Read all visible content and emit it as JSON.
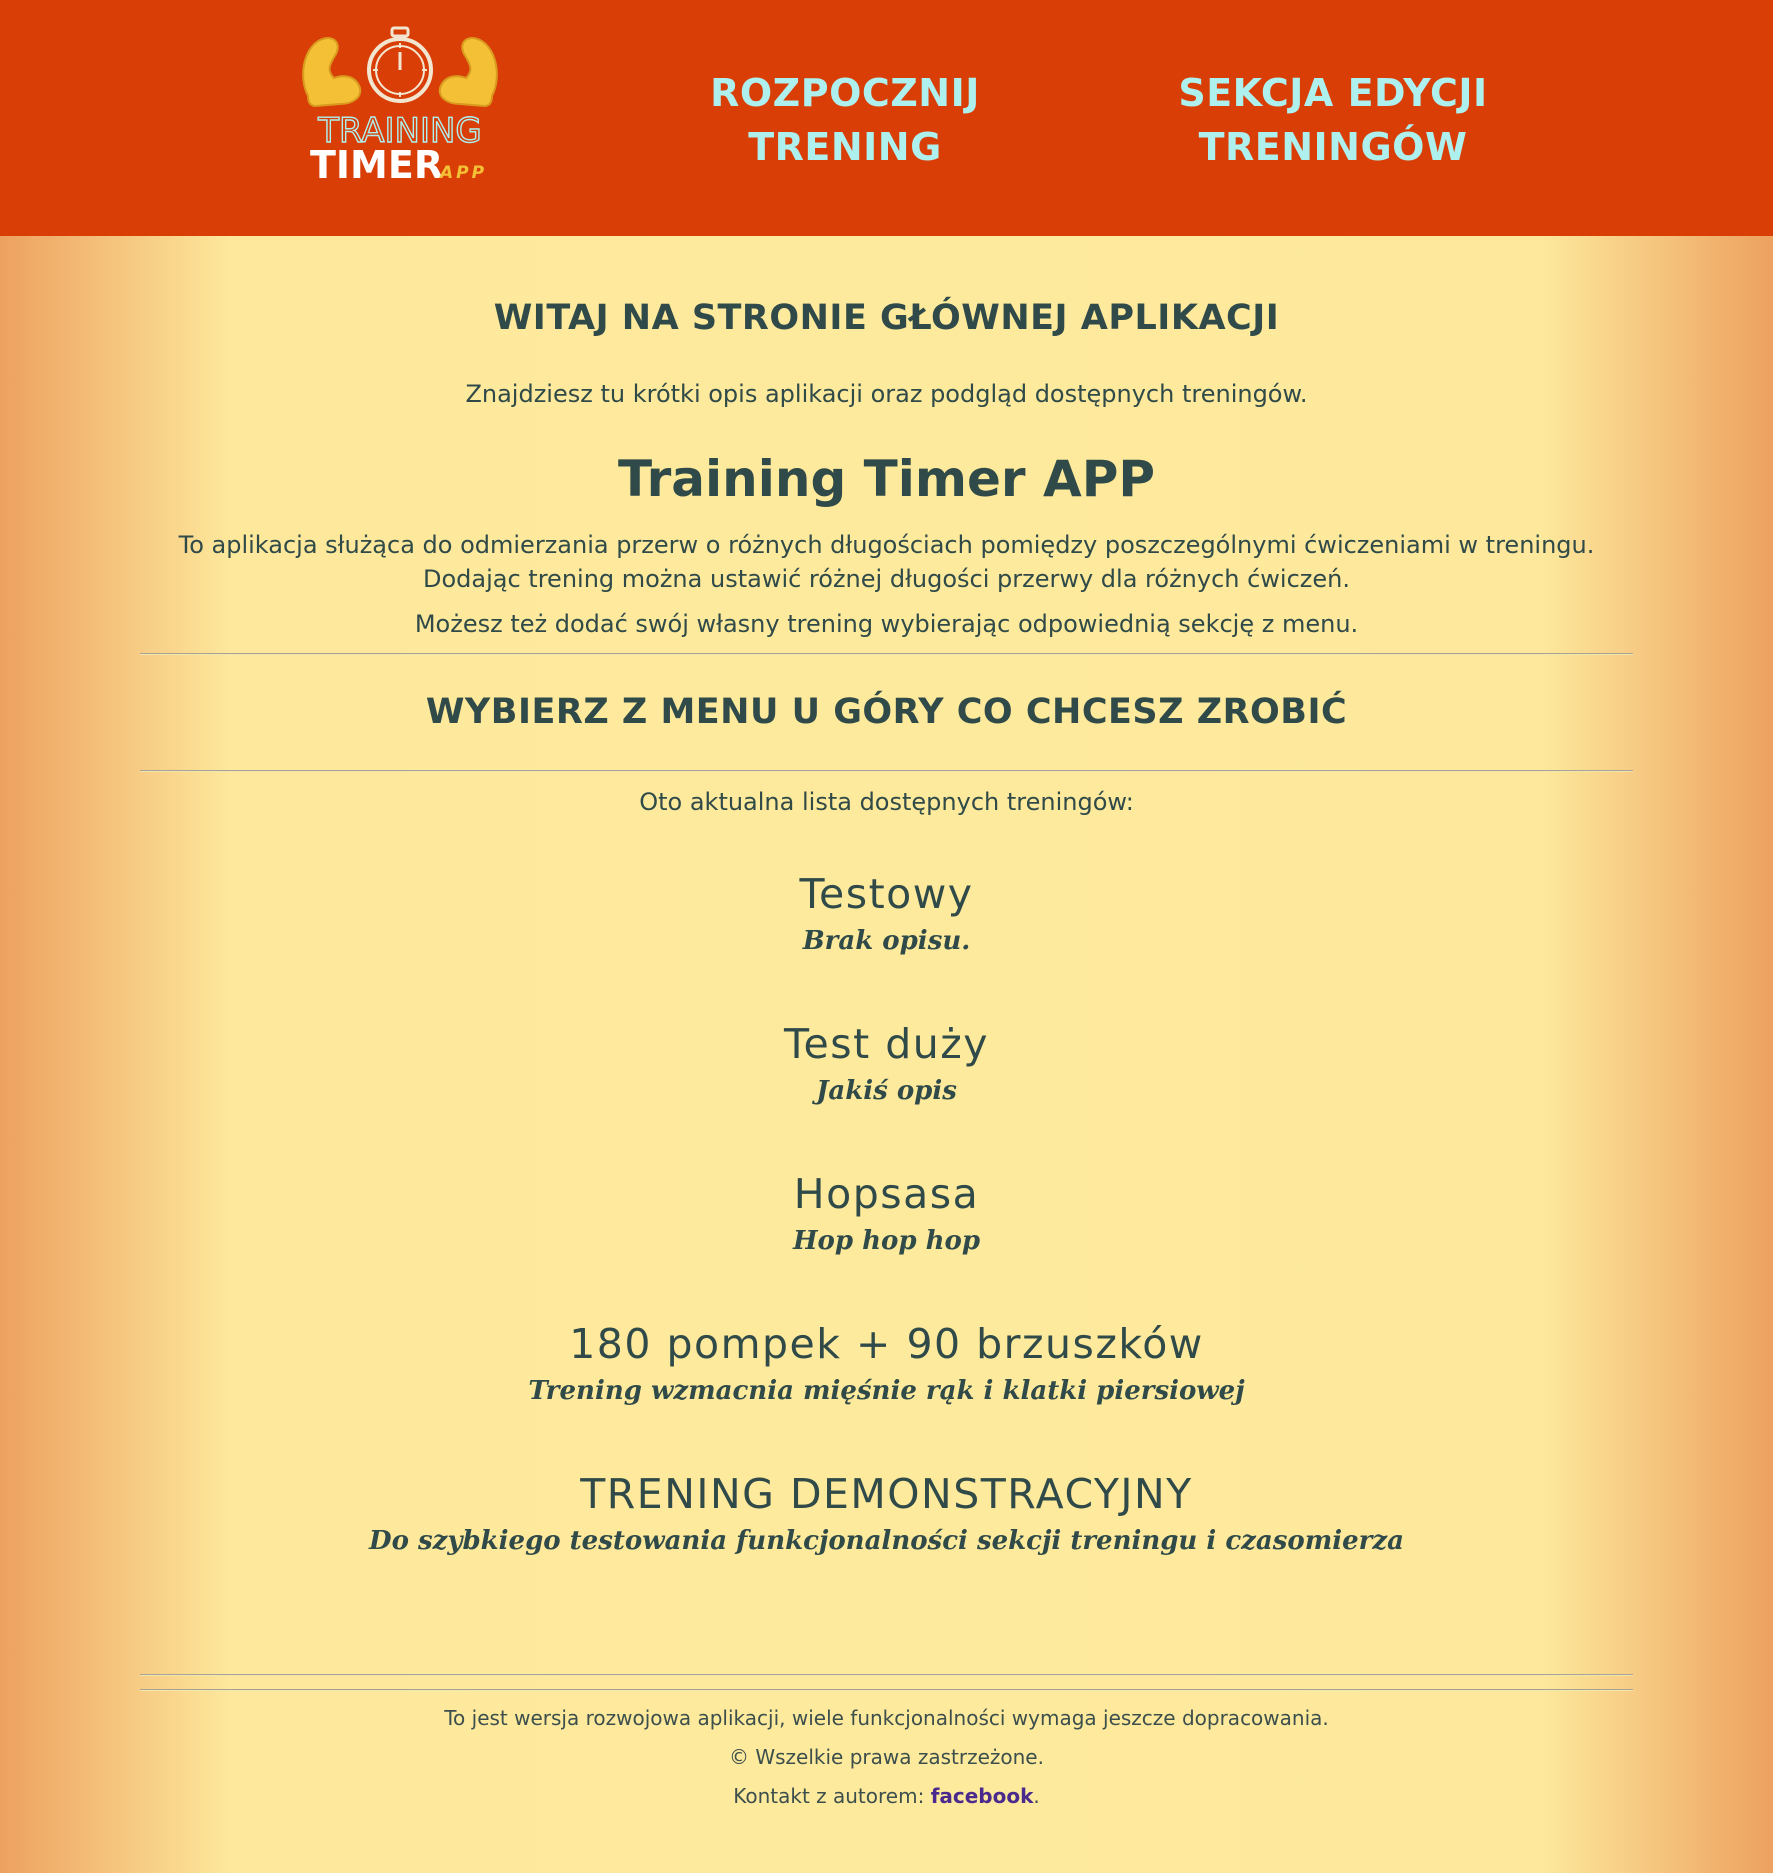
{
  "header": {
    "logo": {
      "line1": "TRAINING",
      "line2": "TIMER",
      "line3": "APP"
    },
    "nav": [
      {
        "line1": "ROZPOCZNIJ",
        "line2": "TRENING"
      },
      {
        "line1": "SEKCJA EDYCJI",
        "line2": "TRENINGÓW"
      }
    ],
    "colors": {
      "background": "#d83e06",
      "nav_text": "#aef0ee"
    }
  },
  "main": {
    "welcome_heading": "WITAJ NA STRONIE GŁÓWNEJ APLIKACJI",
    "intro": "Znajdziesz tu krótki opis aplikacji oraz podgląd dostępnych treningów.",
    "app_title": "Training Timer APP",
    "description_line1": "To aplikacja służąca do odmierzania przerw o różnych długościach pomiędzy poszczególnymi ćwiczeniami w treningu.",
    "description_line2": "Dodając trening można ustawić różnej długości przerwy dla różnych ćwiczeń.",
    "description_extra": "Możesz też dodać swój własny trening wybierając odpowiednią sekcję z menu.",
    "menu_heading": "WYBIERZ Z MENU U GÓRY CO CHCESZ ZROBIĆ",
    "list_intro": "Oto aktualna lista dostępnych treningów:",
    "trainings": [
      {
        "name": "Testowy",
        "description": "Brak opisu."
      },
      {
        "name": "Test duży",
        "description": "Jakiś opis"
      },
      {
        "name": "Hopsasa",
        "description": "Hop hop hop"
      },
      {
        "name": "180 pompek + 90 brzuszków",
        "description": "Trening wzmacnia mięśnie rąk i klatki piersiowej"
      },
      {
        "name": "TRENING DEMONSTRACYJNY",
        "description": "Do szybkiego testowania funkcjonalności sekcji treningu i czasomierza"
      }
    ]
  },
  "footer": {
    "dev_note": "To jest wersja rozwojowa aplikacji, wiele funkcjonalności wymaga jeszcze dopracowania.",
    "copyright": "© Wszelkie prawa zastrzeżone.",
    "contact_label": "Kontakt z autorem: ",
    "contact_link": "facebook",
    "contact_suffix": "."
  },
  "colors": {
    "text": "#2f4a48",
    "page_center": "#feea9c",
    "page_edge": "#eda160",
    "link": "#4a2a8c"
  }
}
